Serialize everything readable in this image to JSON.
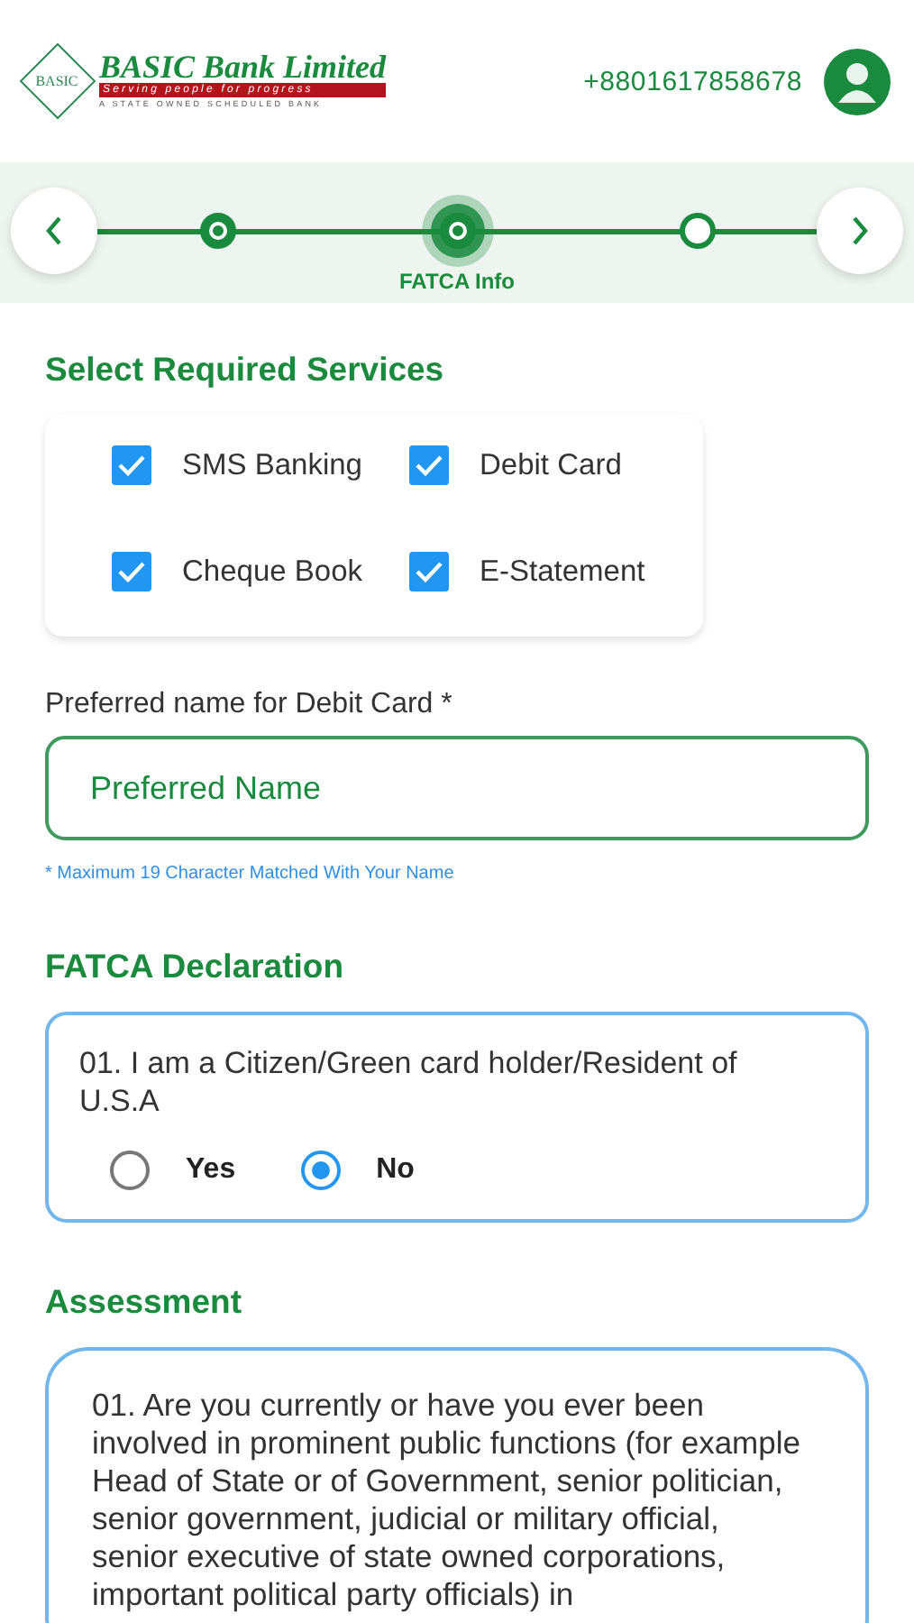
{
  "header": {
    "logo": {
      "emblem": "BASIC",
      "name": "BASIC Bank Limited",
      "tagline": "Serving people for progress",
      "subline": "A STATE OWNED SCHEDULED BANK"
    },
    "phone": "+8801617858678"
  },
  "stepper": {
    "steps": [
      {
        "completed": true,
        "selected": false
      },
      {
        "completed": true,
        "selected": true,
        "label": "FATCA Info"
      },
      {
        "completed": false,
        "selected": false
      }
    ]
  },
  "services": {
    "title": "Select Required Services",
    "options": [
      {
        "label": "SMS Banking",
        "checked": true
      },
      {
        "label": "Debit Card",
        "checked": true
      },
      {
        "label": "Cheque Book",
        "checked": true
      },
      {
        "label": "E-Statement",
        "checked": true
      }
    ]
  },
  "preferred_name": {
    "label": "Preferred name for Debit Card *",
    "placeholder": "Preferred Name",
    "hint": "* Maximum 19 Character Matched With Your Name"
  },
  "fatca": {
    "title": "FATCA Declaration",
    "question": "01. I am a Citizen/Green card holder/Resident of U.S.A",
    "options": [
      {
        "label": "Yes",
        "selected": false
      },
      {
        "label": "No",
        "selected": true
      }
    ]
  },
  "assessment": {
    "title": "Assessment",
    "question": "01. Are you currently or have you ever been involved in prominent public functions (for example Head of State or of Government, senior politician, senior government, judicial or military official, senior executive of state owned corporations, important political party officials) in"
  }
}
